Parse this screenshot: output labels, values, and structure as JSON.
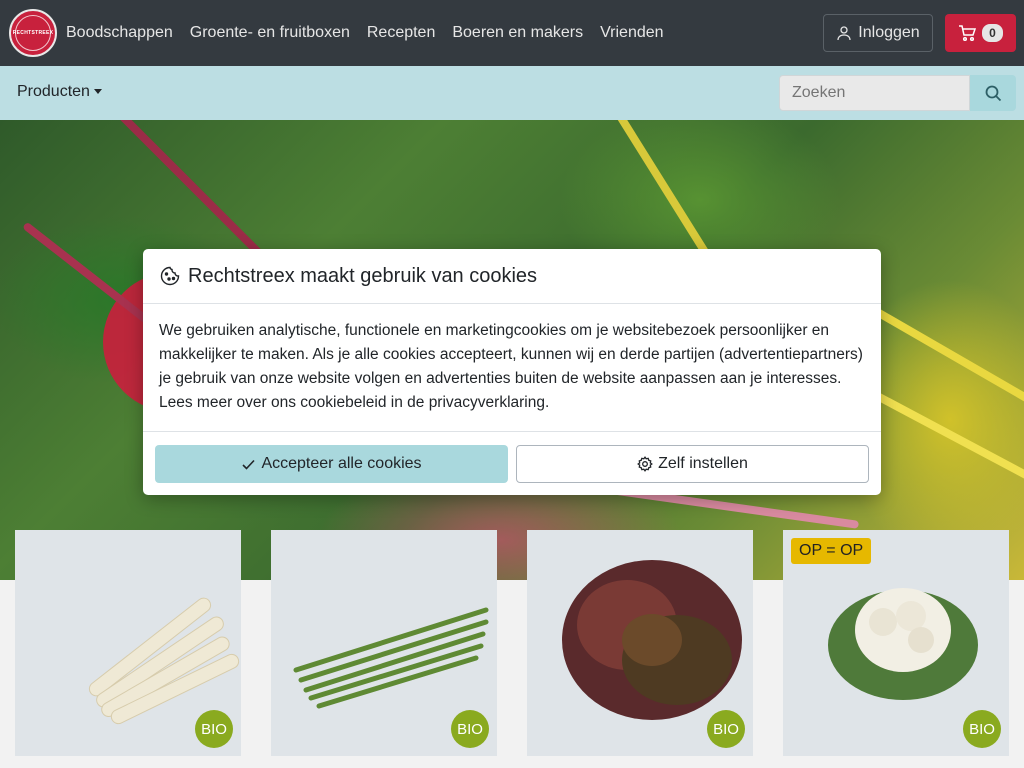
{
  "header": {
    "logo_text": "RECHTSTREEX",
    "nav": [
      "Boodschappen",
      "Groente- en fruitboxen",
      "Recepten",
      "Boeren en makers",
      "Vrienden"
    ],
    "login_label": "Inloggen",
    "cart_count": "0"
  },
  "subbar": {
    "products_label": "Producten",
    "search_placeholder": "Zoeken"
  },
  "modal": {
    "title": "Rechtstreex maakt gebruik van cookies",
    "body": "We gebruiken analytische, functionele en marketingcookies om je websitebezoek persoonlijker en makkelijker te maken. Als je alle cookies accepteert, kunnen wij en derde partijen (advertentiepartners) je gebruik van onze website volgen en advertenties buiten de website aanpassen aan je interesses. Lees meer over ons cookiebeleid in de privacyverklaring.",
    "accept_label": "Accepteer alle cookies",
    "settings_label": "Zelf instellen"
  },
  "products": [
    {
      "badge": "BIO",
      "tag": ""
    },
    {
      "badge": "BIO",
      "tag": ""
    },
    {
      "badge": "BIO",
      "tag": ""
    },
    {
      "badge": "BIO",
      "tag": "OP = OP"
    }
  ],
  "colors": {
    "navbar": "#343a40",
    "brand_red": "#c8213d",
    "subbar": "#bcdee3",
    "accept_button": "#a9d8dd",
    "bio_badge": "#8aaa1f",
    "op_tag": "#e6b800"
  }
}
